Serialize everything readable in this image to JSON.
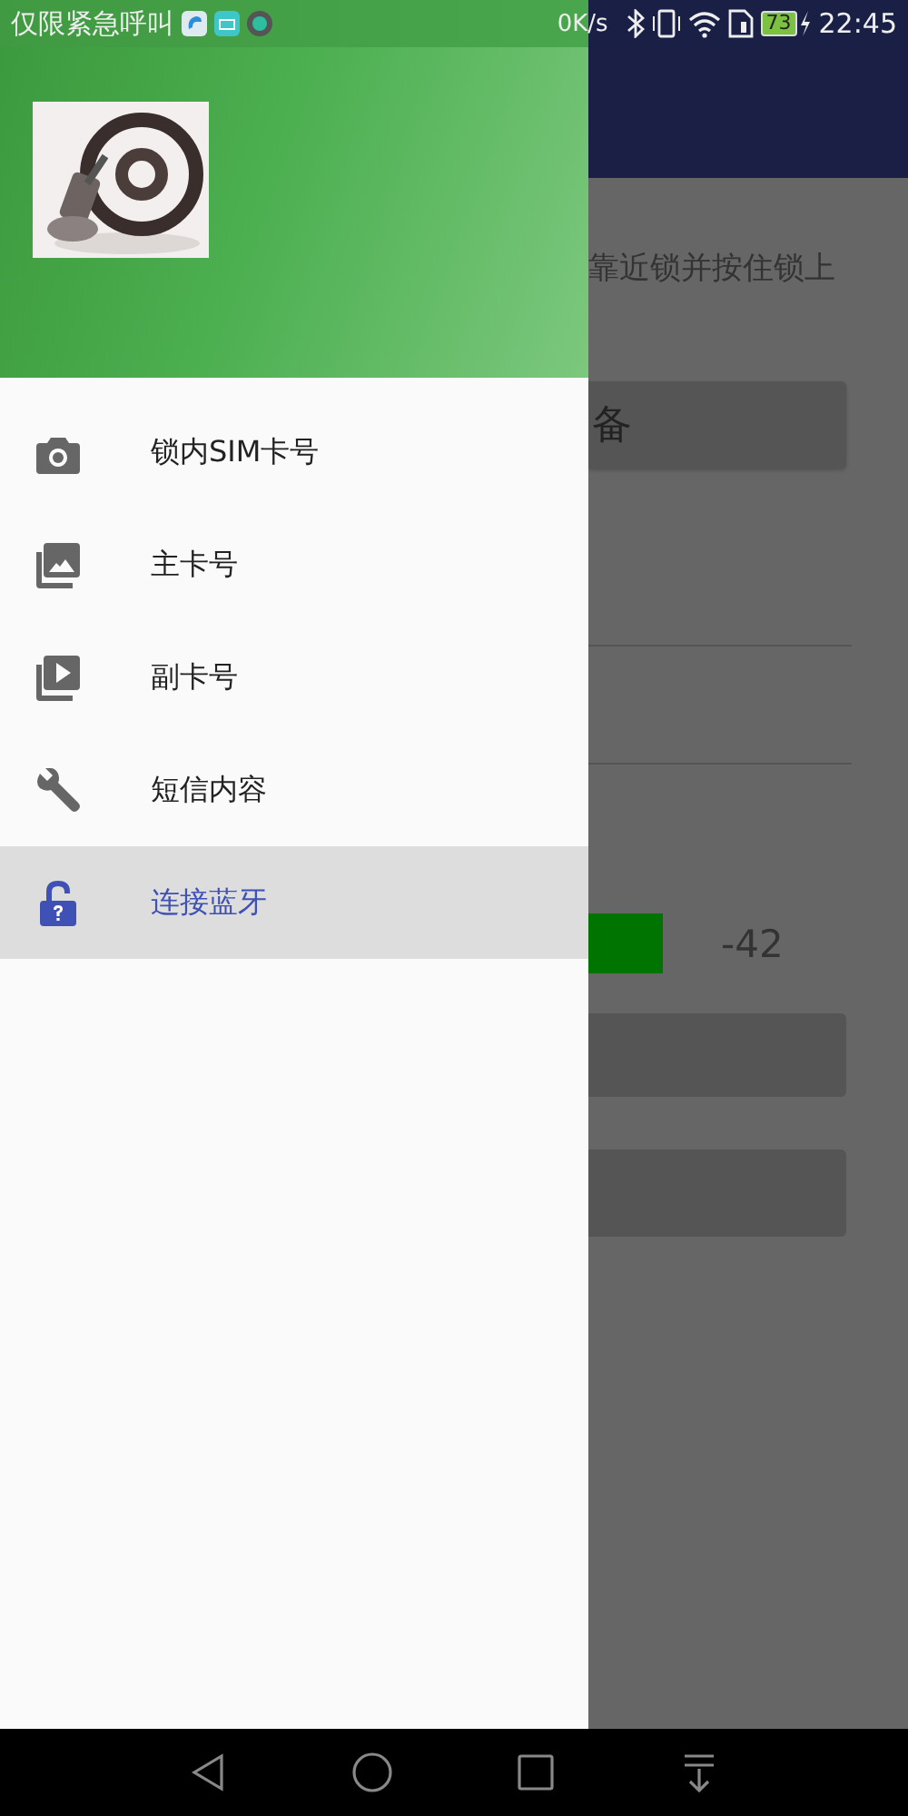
{
  "status_bar": {
    "carrier": "仅限紧急呼叫",
    "network_speed": "0K/s",
    "battery": "73",
    "time": "22:45"
  },
  "background": {
    "instruction": "靠近锁并按住锁上",
    "button_label": "备",
    "signal_reading": "-42"
  },
  "drawer": {
    "items": [
      {
        "label": "锁内SIM卡号",
        "selected": false
      },
      {
        "label": "主卡号",
        "selected": false
      },
      {
        "label": "副卡号",
        "selected": false
      },
      {
        "label": "短信内容",
        "selected": false
      },
      {
        "label": "连接蓝牙",
        "selected": true
      }
    ]
  }
}
